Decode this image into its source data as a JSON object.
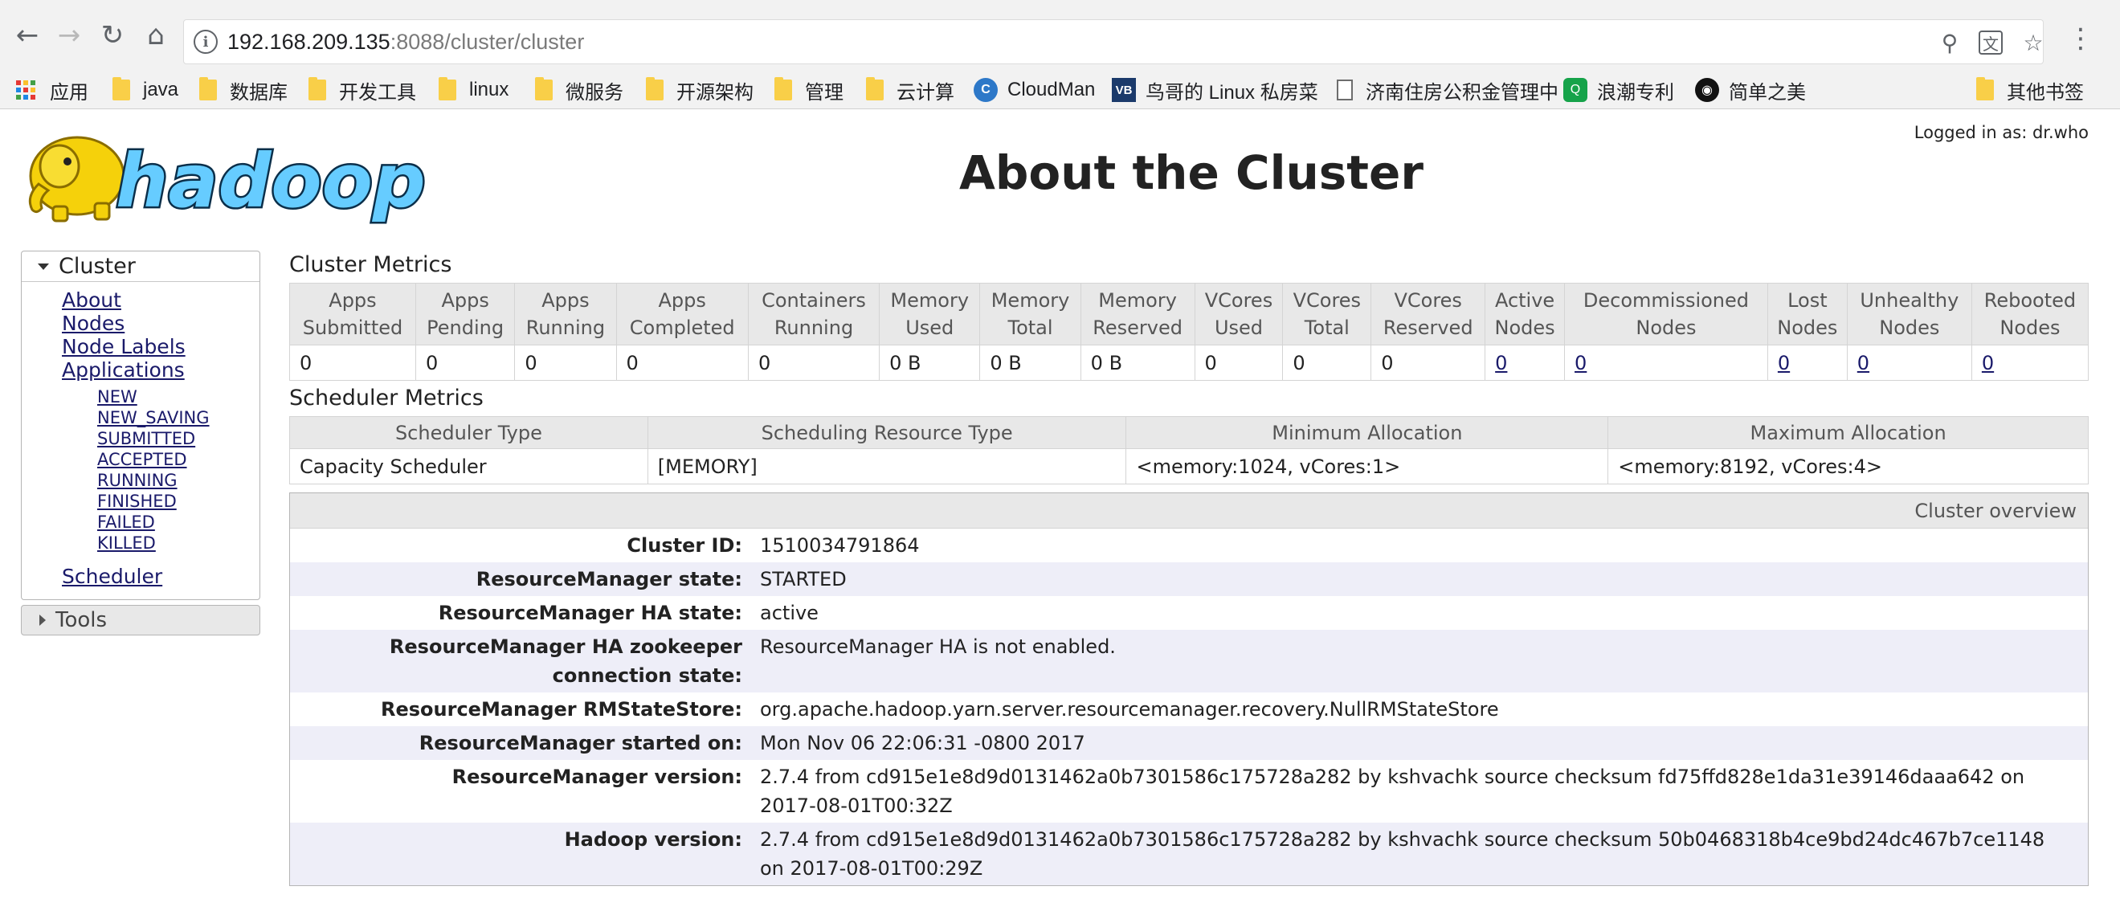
{
  "browser": {
    "url_host": "192.168.209.135",
    "url_rest": ":8088/cluster/cluster",
    "bookmarks": [
      {
        "label": "应用",
        "icon": "apps-grid-icon"
      },
      {
        "label": "java",
        "icon": "folder-icon"
      },
      {
        "label": "数据库",
        "icon": "folder-icon"
      },
      {
        "label": "开发工具",
        "icon": "folder-icon"
      },
      {
        "label": "linux",
        "icon": "folder-icon"
      },
      {
        "label": "微服务",
        "icon": "folder-icon"
      },
      {
        "label": "开源架构",
        "icon": "folder-icon"
      },
      {
        "label": "管理",
        "icon": "folder-icon"
      },
      {
        "label": "云计算",
        "icon": "folder-icon"
      },
      {
        "label": "CloudMan",
        "icon": "cloudman-icon"
      },
      {
        "label": "鸟哥的 Linux 私房菜",
        "icon": "vbird-icon"
      },
      {
        "label": "济南住房公积金管理中",
        "icon": "page-icon"
      },
      {
        "label": "浪潮专利",
        "icon": "patent-icon"
      },
      {
        "label": "简单之美",
        "icon": "alien-icon"
      },
      {
        "label": "其他书签",
        "icon": "folder-icon"
      }
    ],
    "colors": {
      "folder": "#f9cf48",
      "link": "#1a1a6a",
      "header_bg": "#e8e8e8",
      "alt_row": "#eeeef8"
    }
  },
  "header": {
    "logged_in": "Logged in as: dr.who",
    "title": "About the Cluster",
    "logo_text": "hadoop"
  },
  "sidebar": {
    "cluster_label": "Cluster",
    "links": [
      "About",
      "Nodes",
      "Node Labels",
      "Applications"
    ],
    "app_states": [
      "NEW",
      "NEW_SAVING",
      "SUBMITTED",
      "ACCEPTED",
      "RUNNING",
      "FINISHED",
      "FAILED",
      "KILLED"
    ],
    "scheduler": "Scheduler",
    "tools_label": "Tools"
  },
  "cluster_metrics": {
    "title": "Cluster Metrics",
    "headers": [
      [
        "Apps",
        "Submitted"
      ],
      [
        "Apps",
        "Pending"
      ],
      [
        "Apps",
        "Running"
      ],
      [
        "Apps",
        "Completed"
      ],
      [
        "Containers",
        "Running"
      ],
      [
        "Memory",
        "Used"
      ],
      [
        "Memory",
        "Total"
      ],
      [
        "Memory",
        "Reserved"
      ],
      [
        "VCores",
        "Used"
      ],
      [
        "VCores",
        "Total"
      ],
      [
        "VCores",
        "Reserved"
      ],
      [
        "Active",
        "Nodes"
      ],
      [
        "Decommissioned",
        "Nodes"
      ],
      [
        "Lost",
        "Nodes"
      ],
      [
        "Unhealthy",
        "Nodes"
      ],
      [
        "Rebooted",
        "Nodes"
      ]
    ],
    "values": [
      "0",
      "0",
      "0",
      "0",
      "0",
      "0 B",
      "0 B",
      "0 B",
      "0",
      "0",
      "0",
      "0",
      "0",
      "0",
      "0",
      "0"
    ]
  },
  "scheduler_metrics": {
    "title": "Scheduler Metrics",
    "headers": [
      "Scheduler Type",
      "Scheduling Resource Type",
      "Minimum Allocation",
      "Maximum Allocation"
    ],
    "values": [
      "Capacity Scheduler",
      "[MEMORY]",
      "<memory:1024, vCores:1>",
      "<memory:8192, vCores:4>"
    ]
  },
  "overview": {
    "title": "Cluster overview",
    "rows": [
      {
        "key": "Cluster ID:",
        "value": "1510034791864"
      },
      {
        "key": "ResourceManager state:",
        "value": "STARTED"
      },
      {
        "key": "ResourceManager HA state:",
        "value": "active"
      },
      {
        "key": "ResourceManager HA zookeeper connection state:",
        "value": "ResourceManager HA is not enabled."
      },
      {
        "key": "ResourceManager RMStateStore:",
        "value": "org.apache.hadoop.yarn.server.resourcemanager.recovery.NullRMStateStore"
      },
      {
        "key": "ResourceManager started on:",
        "value": "Mon Nov 06 22:06:31 -0800 2017"
      },
      {
        "key": "ResourceManager version:",
        "value": "2.7.4 from cd915e1e8d9d0131462a0b7301586c175728a282 by kshvachk source checksum fd75ffd828e1da31e39146daaa642 on 2017-08-01T00:32Z"
      },
      {
        "key": "Hadoop version:",
        "value": "2.7.4 from cd915e1e8d9d0131462a0b7301586c175728a282 by kshvachk source checksum 50b0468318b4ce9bd24dc467b7ce1148 on 2017-08-01T00:29Z"
      }
    ]
  }
}
